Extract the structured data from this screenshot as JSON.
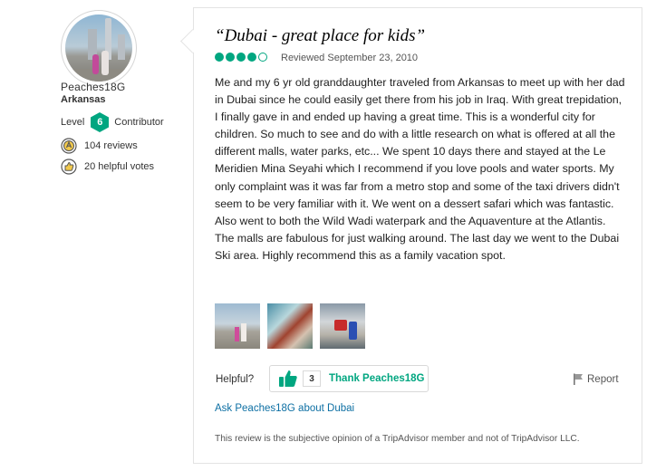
{
  "reviewer": {
    "username": "Peaches18G",
    "location": "Arkansas",
    "level_label": "Level",
    "level_number": "6",
    "level_title": "Contributor",
    "reviews_count": "104 reviews",
    "helpful_votes": "20 helpful votes",
    "avatar_icon": "avatar-photo"
  },
  "review": {
    "title": "“Dubai - great place for kids”",
    "rating": 4,
    "rating_max": 5,
    "reviewed_date": "Reviewed September 23, 2010",
    "body": "Me and my 6 yr old granddaughter traveled from Arkansas to meet up with her dad in Dubai since he could easily get there from his job in Iraq. With great trepidation, I finally gave in and ended up having a great time. This is a wonderful city for children. So much to see and do with a little research on what is offered at all the different malls, water parks, etc... We spent 10 days there and stayed at the Le Meridien Mina Seyahi which I recommend if you love pools and water sports. My only complaint was it was far from a metro stop and some of the taxi drivers didn't seem to be very familiar with it. We went on a dessert safari which was fantastic. Also went to both the Wild Wadi waterpark and the Aquaventure at the Atlantis. The malls are fabulous for just walking around. The last day we went to the Dubai Ski area. Highly recommend this as a family vacation spot.",
    "photo_count": 3
  },
  "actions": {
    "helpful_label": "Helpful?",
    "thank_count": "3",
    "thank_label": "Thank Peaches18G",
    "report_label": "Report",
    "ask_link": "Ask Peaches18G about Dubai"
  },
  "footer": {
    "disclaimer": "This review is the subjective opinion of a TripAdvisor member and not of TripAdvisor LLC."
  },
  "colors": {
    "accent": "#00a680",
    "link": "#0d6fa3"
  }
}
